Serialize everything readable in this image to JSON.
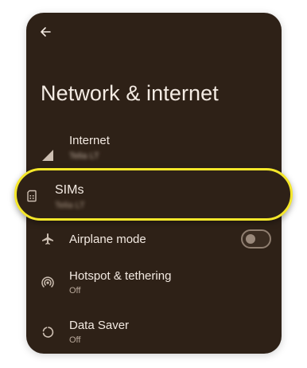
{
  "header": {
    "back_icon": "arrow-left-icon",
    "title": "Network & internet"
  },
  "items": [
    {
      "icon": "signal-icon",
      "label": "Internet",
      "subtitle": "Telia LT",
      "subtitle_obscured": true
    },
    {
      "icon": "sim-card-icon",
      "label": "SIMs",
      "subtitle": "Telia LT",
      "subtitle_obscured": true,
      "highlighted": true
    },
    {
      "icon": "airplane-icon",
      "label": "Airplane mode",
      "toggle": {
        "state": "off"
      }
    },
    {
      "icon": "hotspot-icon",
      "label": "Hotspot & tethering",
      "subtitle": "Off"
    },
    {
      "icon": "data-saver-icon",
      "label": "Data Saver",
      "subtitle": "Off"
    }
  ],
  "colors": {
    "background": "#2e2117",
    "text_primary": "#f4ebe3",
    "text_secondary": "#b9a99b",
    "highlight_border": "#f5e72a"
  }
}
